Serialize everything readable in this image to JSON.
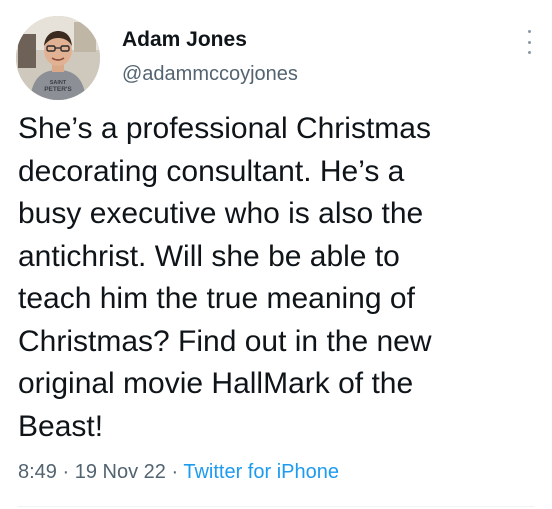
{
  "tweet": {
    "author_name": "Adam Jones",
    "author_handle": "@adammccoyjones",
    "text": "She’s a professional Christmas\ndecorating consultant. He’s a\nbusy executive who is also the\nantichrist. Will she be able to\nteach him the true meaning of\nChristmas? Find out in the new\noriginal movie HallMark of the\nBeast!",
    "time": "8:49",
    "date": "19 Nov 22",
    "separator": "·",
    "source": "Twitter for iPhone"
  },
  "avatar": {
    "shirt_text_line1": "SAINT",
    "shirt_text_line2": "PETER'S"
  },
  "colors": {
    "text": "#0f1419",
    "secondary": "#536471",
    "link": "#1d9bf0",
    "more_icon": "#8b98a5"
  },
  "icons": {
    "more": "more-vertical-icon"
  }
}
